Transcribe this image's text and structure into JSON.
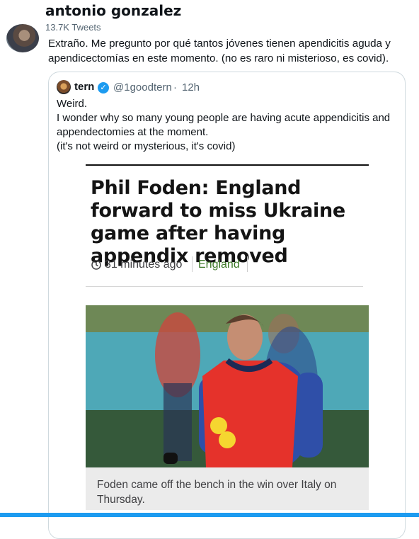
{
  "header": {
    "name": "antonio gonzalez",
    "tweet_count": "13.7K Tweets"
  },
  "tweet": {
    "text": "Extraño. Me pregunto por qué tantos jóvenes tienen apendicitis aguda y apendicectomías en este momento. (no es raro ni misterioso, es covid)."
  },
  "quote": {
    "name": "tern",
    "handle": "@1goodtern",
    "separator": "·",
    "time": "12h",
    "lines": [
      "Weird.",
      "I wonder why so many young people are having acute appendicitis and appendectomies at the moment.",
      "(it's not weird or mysterious, it's covid)"
    ]
  },
  "article": {
    "headline": "Phil Foden: England forward to miss Ukraine game after having appendix removed",
    "time": "31 minutes ago",
    "tag": "England",
    "caption": "Foden came off the bench in the win over Italy on Thursday."
  },
  "colors": {
    "accent": "#1d9bf0",
    "tag_green": "#3f7a2a",
    "bib_red": "#e5322b",
    "kit_blue": "#2f4fa8"
  },
  "icons": {
    "verified": "verified-badge-icon",
    "clock": "clock-icon"
  }
}
